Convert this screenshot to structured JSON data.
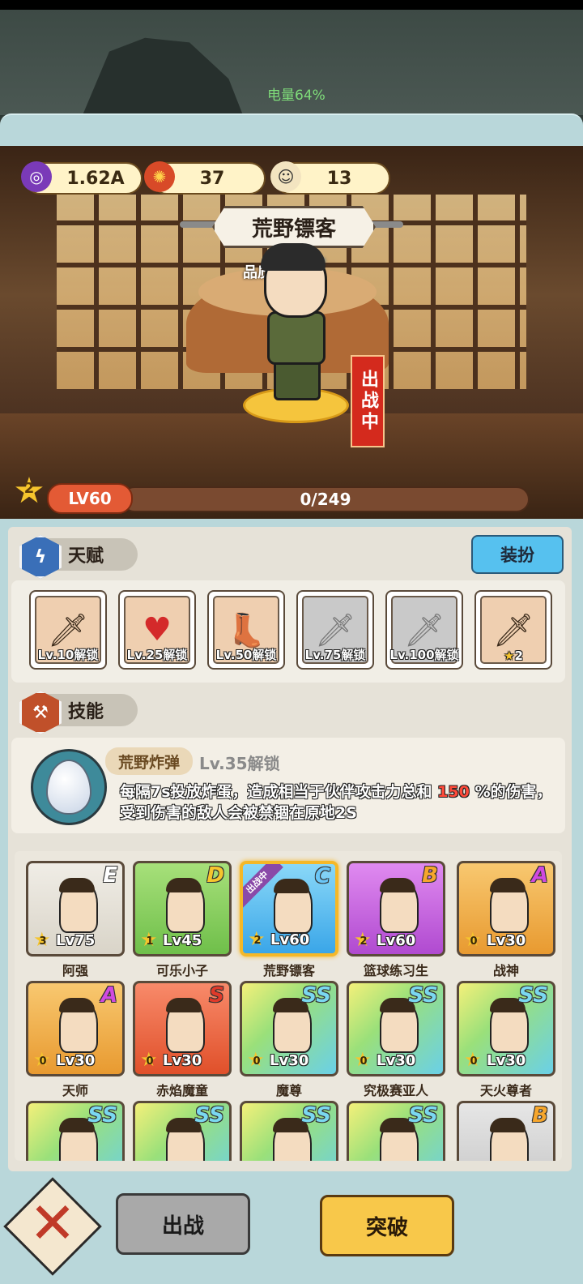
{
  "status": {
    "battery_text": "电量64%"
  },
  "currencies": [
    {
      "icon": "purple-orb-icon",
      "value": "1.62A"
    },
    {
      "icon": "fire-coin-icon",
      "value": "37"
    },
    {
      "icon": "hero-fragment-icon",
      "value": "13"
    }
  ],
  "hero": {
    "name": "荒野镖客",
    "quality_label": "品质:",
    "quality_grade": "C",
    "status_tag": "出战中",
    "star_count": "2",
    "level": "LV60",
    "exp_text": "0/249"
  },
  "talent": {
    "section_label": "天赋",
    "outfit_button": "装扮",
    "items": [
      {
        "label": "Lv.10解锁",
        "icon": "dagger-icon"
      },
      {
        "label": "Lv.25解锁",
        "icon": "heart-icon"
      },
      {
        "label": "Lv.50解锁",
        "icon": "winged-boot-icon"
      },
      {
        "label": "Lv.75解锁",
        "icon": "dagger-icon"
      },
      {
        "label": "Lv.100解锁",
        "icon": "dagger-icon"
      },
      {
        "label": "2",
        "icon": "dagger-icon"
      }
    ]
  },
  "skill": {
    "section_label": "技能",
    "name": "荒野炸弹",
    "unlock": "Lv.35解锁",
    "desc_prefix": "每隔7s投放炸蛋，造成相当于伙伴攻击力总和",
    "desc_value": "150",
    "desc_suffix": "%的伤害，受到伤害的敌人会被禁锢在原地2S"
  },
  "roster": [
    {
      "name": "阿强",
      "grade": "E",
      "stars": "3",
      "level": "Lv75"
    },
    {
      "name": "可乐小子",
      "grade": "D",
      "stars": "1",
      "level": "Lv45"
    },
    {
      "name": "荒野镖客",
      "grade": "C",
      "stars": "2",
      "level": "Lv60",
      "badge": "出战中"
    },
    {
      "name": "篮球练习生",
      "grade": "B",
      "stars": "2",
      "level": "Lv60"
    },
    {
      "name": "战神",
      "grade": "A",
      "stars": "0",
      "level": "Lv30"
    },
    {
      "name": "天师",
      "grade": "A",
      "stars": "0",
      "level": "Lv30"
    },
    {
      "name": "赤焰魔童",
      "grade": "S",
      "stars": "0",
      "level": "Lv30"
    },
    {
      "name": "魔尊",
      "grade": "SS",
      "stars": "0",
      "level": "Lv30"
    },
    {
      "name": "究极赛亚人",
      "grade": "SS",
      "stars": "0",
      "level": "Lv30"
    },
    {
      "name": "天火尊者",
      "grade": "SS",
      "stars": "0",
      "level": "Lv30"
    },
    {
      "name": "",
      "grade": "SS",
      "stars": "",
      "level": ""
    },
    {
      "name": "",
      "grade": "SS",
      "stars": "",
      "level": ""
    },
    {
      "name": "",
      "grade": "SS",
      "stars": "",
      "level": ""
    },
    {
      "name": "",
      "grade": "SS",
      "stars": "",
      "level": ""
    },
    {
      "name": "",
      "grade": "B",
      "stars": "",
      "level": ""
    }
  ],
  "actions": {
    "deploy": "出战",
    "breakthrough": "突破"
  },
  "colors": {
    "accent_blue": "#56c1ef",
    "accent_gold": "#f8c84a",
    "deploy_red": "#d42a1d",
    "panel": "#b9d7da"
  }
}
